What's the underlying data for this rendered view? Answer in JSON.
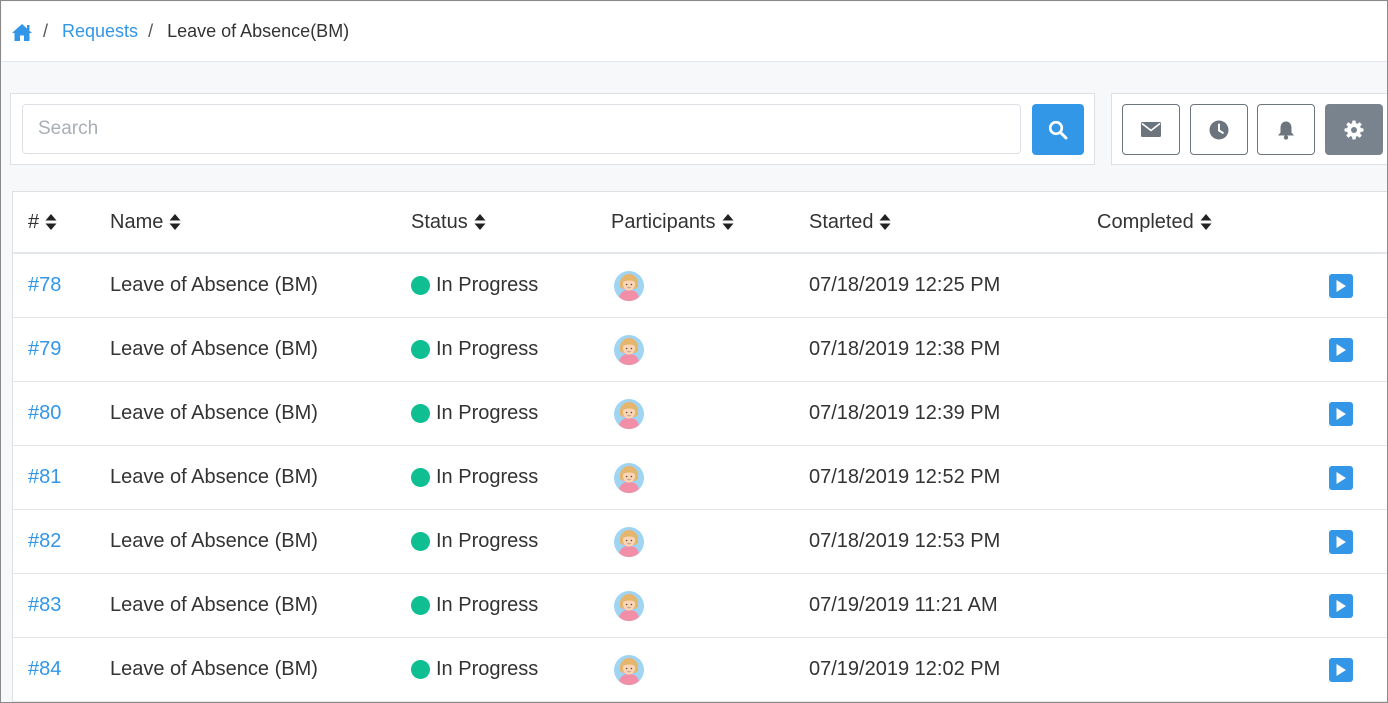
{
  "breadcrumb": {
    "home_icon": "home-icon",
    "separator": "/",
    "items": [
      {
        "label": "Requests"
      },
      {
        "label": "Leave of Absence(BM)"
      }
    ]
  },
  "search": {
    "placeholder": "Search",
    "value": "",
    "button_icon": "search-icon"
  },
  "toolbar": {
    "buttons": [
      {
        "icon": "envelope-icon"
      },
      {
        "icon": "clock-icon"
      },
      {
        "icon": "bell-icon"
      },
      {
        "icon": "gear-icon"
      }
    ]
  },
  "table": {
    "columns": [
      {
        "label": "#"
      },
      {
        "label": "Name"
      },
      {
        "label": "Status"
      },
      {
        "label": "Participants"
      },
      {
        "label": "Started"
      },
      {
        "label": "Completed"
      }
    ],
    "rows": [
      {
        "id": "#78",
        "name": "Leave of Absence (BM)",
        "status": "In Progress",
        "started": "07/18/2019 12:25 PM",
        "completed": ""
      },
      {
        "id": "#79",
        "name": "Leave of Absence (BM)",
        "status": "In Progress",
        "started": "07/18/2019 12:38 PM",
        "completed": ""
      },
      {
        "id": "#80",
        "name": "Leave of Absence (BM)",
        "status": "In Progress",
        "started": "07/18/2019 12:39 PM",
        "completed": ""
      },
      {
        "id": "#81",
        "name": "Leave of Absence (BM)",
        "status": "In Progress",
        "started": "07/18/2019 12:52 PM",
        "completed": ""
      },
      {
        "id": "#82",
        "name": "Leave of Absence (BM)",
        "status": "In Progress",
        "started": "07/18/2019 12:53 PM",
        "completed": ""
      },
      {
        "id": "#83",
        "name": "Leave of Absence (BM)",
        "status": "In Progress",
        "started": "07/19/2019 11:21 AM",
        "completed": ""
      },
      {
        "id": "#84",
        "name": "Leave of Absence (BM)",
        "status": "In Progress",
        "started": "07/19/2019 12:02 PM",
        "completed": ""
      }
    ]
  },
  "colors": {
    "accent": "#3396e6",
    "status_in_progress": "#0fbf92",
    "settings_button": "#79838d"
  }
}
